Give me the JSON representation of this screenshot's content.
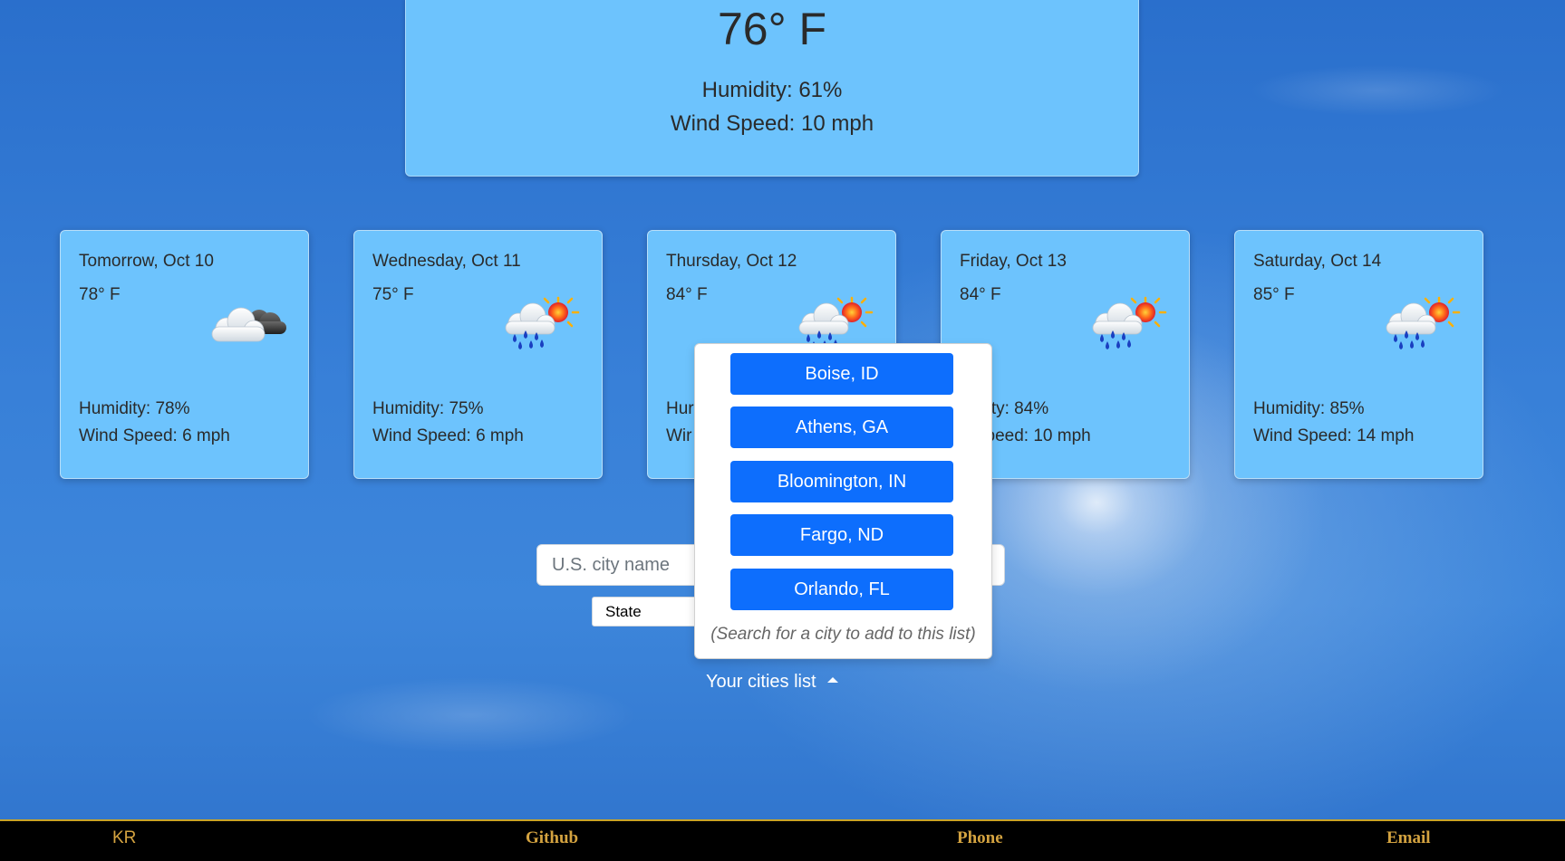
{
  "current": {
    "temperature": "76° F",
    "humidity": "Humidity: 61%",
    "wind": "Wind Speed: 10 mph"
  },
  "forecast": [
    {
      "date": "Tomorrow, Oct 10",
      "temp": "78° F",
      "icon": "partly-cloudy-night-icon",
      "humidity": "Humidity: 78%",
      "wind": "Wind Speed: 6 mph"
    },
    {
      "date": "Wednesday, Oct 11",
      "temp": "75° F",
      "icon": "sun-rain-cloud-icon",
      "humidity": "Humidity: 75%",
      "wind": "Wind Speed: 6 mph"
    },
    {
      "date": "Thursday, Oct 12",
      "temp": "84° F",
      "icon": "sun-rain-cloud-icon",
      "humidity": "Hur",
      "wind": "Wir"
    },
    {
      "date": "Friday, Oct 13",
      "temp": "84° F",
      "icon": "sun-rain-cloud-icon",
      "humidity": "midity: 84%",
      "wind": "d Speed: 10 mph"
    },
    {
      "date": "Saturday, Oct 14",
      "temp": "85° F",
      "icon": "sun-rain-cloud-icon",
      "humidity": "Humidity: 85%",
      "wind": "Wind Speed: 14 mph"
    }
  ],
  "search": {
    "city_placeholder": "U.S. city name",
    "city_value": "",
    "state_selected": "State"
  },
  "cities_dropdown": {
    "toggle_label": "Your cities list",
    "cities": [
      "Boise, ID",
      "Athens, GA",
      "Bloomington, IN",
      "Fargo, ND",
      "Orlando, FL"
    ],
    "hint": "(Search for a city to add to this list)"
  },
  "footer": {
    "initials": "KR",
    "links": [
      "Github",
      "Phone",
      "Email"
    ]
  },
  "colors": {
    "card_background": "#6dc3fd",
    "button_blue": "#0d6efd",
    "footer_text": "#d4a340",
    "footer_background": "#000000"
  }
}
